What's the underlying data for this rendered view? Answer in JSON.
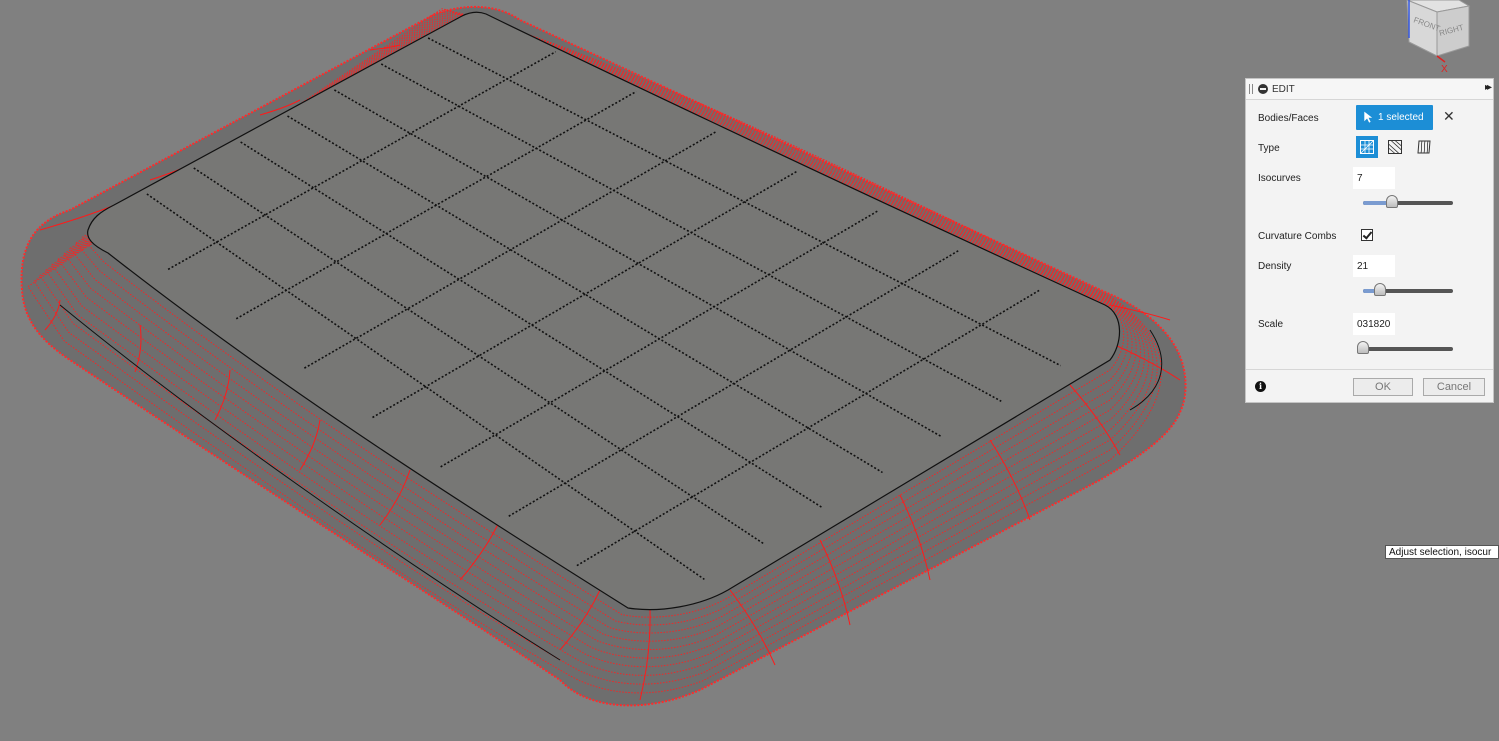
{
  "viewcube": {
    "face_front": "FRONT",
    "face_right": "RIGHT",
    "axis_x": "X"
  },
  "panel": {
    "title": "EDIT",
    "bodies_label": "Bodies/Faces",
    "selected_text": "1 selected",
    "type_label": "Type",
    "type_options": [
      "surface-isocurve-icon",
      "diagonal-hatch-icon",
      "vertical-curve-icon"
    ],
    "isocurves_label": "Isocurves",
    "isocurves_value": "7",
    "isocurves_slider": 0.32,
    "curvature_label": "Curvature Combs",
    "curvature_checked": true,
    "density_label": "Density",
    "density_value": "21",
    "density_slider": 0.19,
    "scale_label": "Scale",
    "scale_value": "031820",
    "scale_slider": 0.0,
    "ok_label": "OK",
    "cancel_label": "Cancel"
  },
  "tooltip": "Adjust selection, isocur",
  "colors": {
    "viewport_bg": "#808080",
    "face_fill": "#767676",
    "comb": "#ff1a1a",
    "accent": "#1c8ed6"
  }
}
